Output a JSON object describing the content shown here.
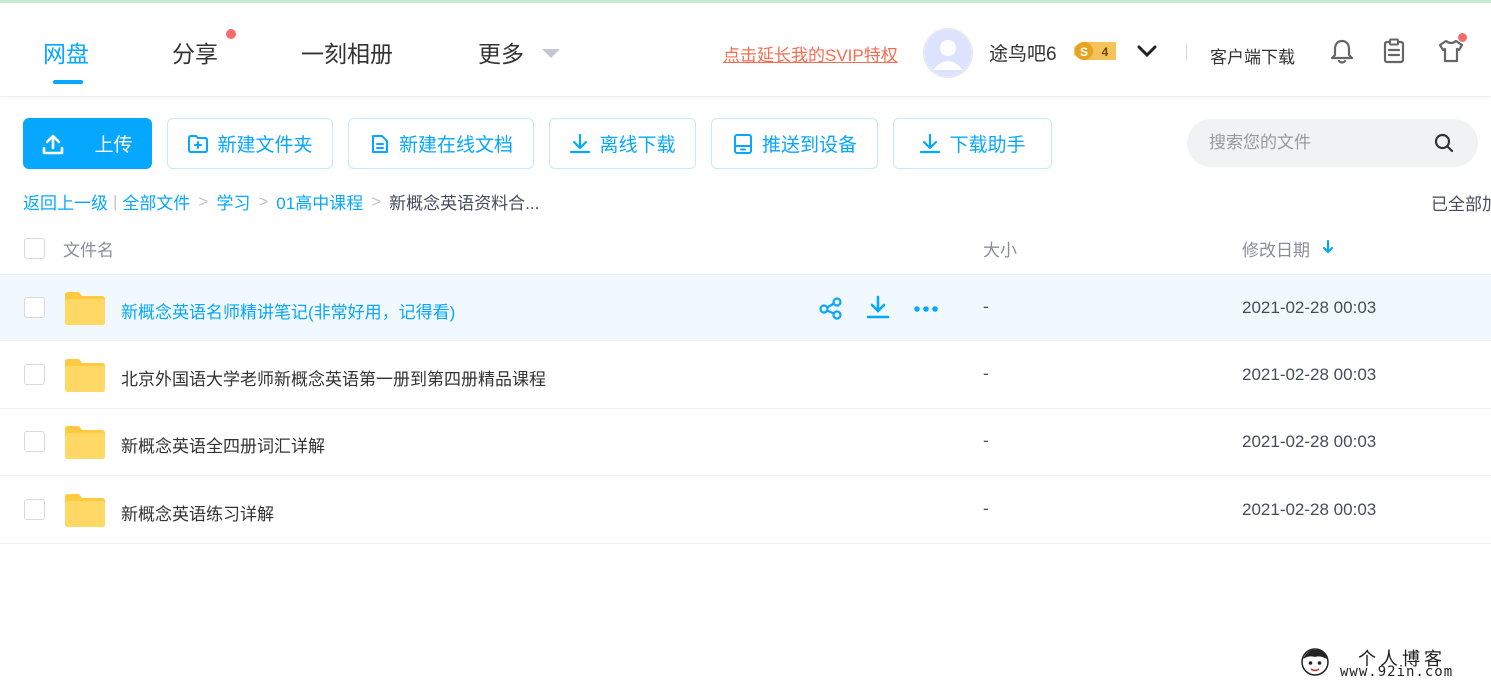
{
  "header": {
    "tabs": [
      {
        "label": "网盘"
      },
      {
        "label": "分享"
      },
      {
        "label": "一刻相册"
      },
      {
        "label": "更多"
      }
    ],
    "svip_link": "点击延长我的SVIP特权",
    "username": "途鸟吧6",
    "vip_level": "4",
    "vip_symbol": "S",
    "client_download": "客户端下载"
  },
  "toolbar": {
    "upload": "上传",
    "new_folder": "新建文件夹",
    "new_doc": "新建在线文档",
    "offline_download": "离线下载",
    "push_device": "推送到设备",
    "download_helper": "下载助手",
    "search_placeholder": "搜索您的文件"
  },
  "breadcrumb": {
    "back": "返回上一级",
    "items": [
      "全部文件",
      "学习",
      "01高中课程"
    ],
    "current": "新概念英语资料合...",
    "status": "已全部加载"
  },
  "table": {
    "headers": {
      "name": "文件名",
      "size": "大小",
      "date": "修改日期"
    },
    "rows": [
      {
        "name": "新概念英语名师精讲笔记(非常好用，记得看)",
        "size": "-",
        "date": "2021-02-28 00:03"
      },
      {
        "name": "北京外国语大学老师新概念英语第一册到第四册精品课程",
        "size": "-",
        "date": "2021-02-28 00:03"
      },
      {
        "name": "新概念英语全四册词汇详解",
        "size": "-",
        "date": "2021-02-28 00:03"
      },
      {
        "name": "新概念英语练习详解",
        "size": "-",
        "date": "2021-02-28 00:03"
      }
    ]
  },
  "watermark": {
    "title": "个人博客",
    "url": "www.92in.com"
  },
  "colors": {
    "accent": "#06a7ff",
    "svip": "#f56c50",
    "folder": "#ffd46b"
  }
}
